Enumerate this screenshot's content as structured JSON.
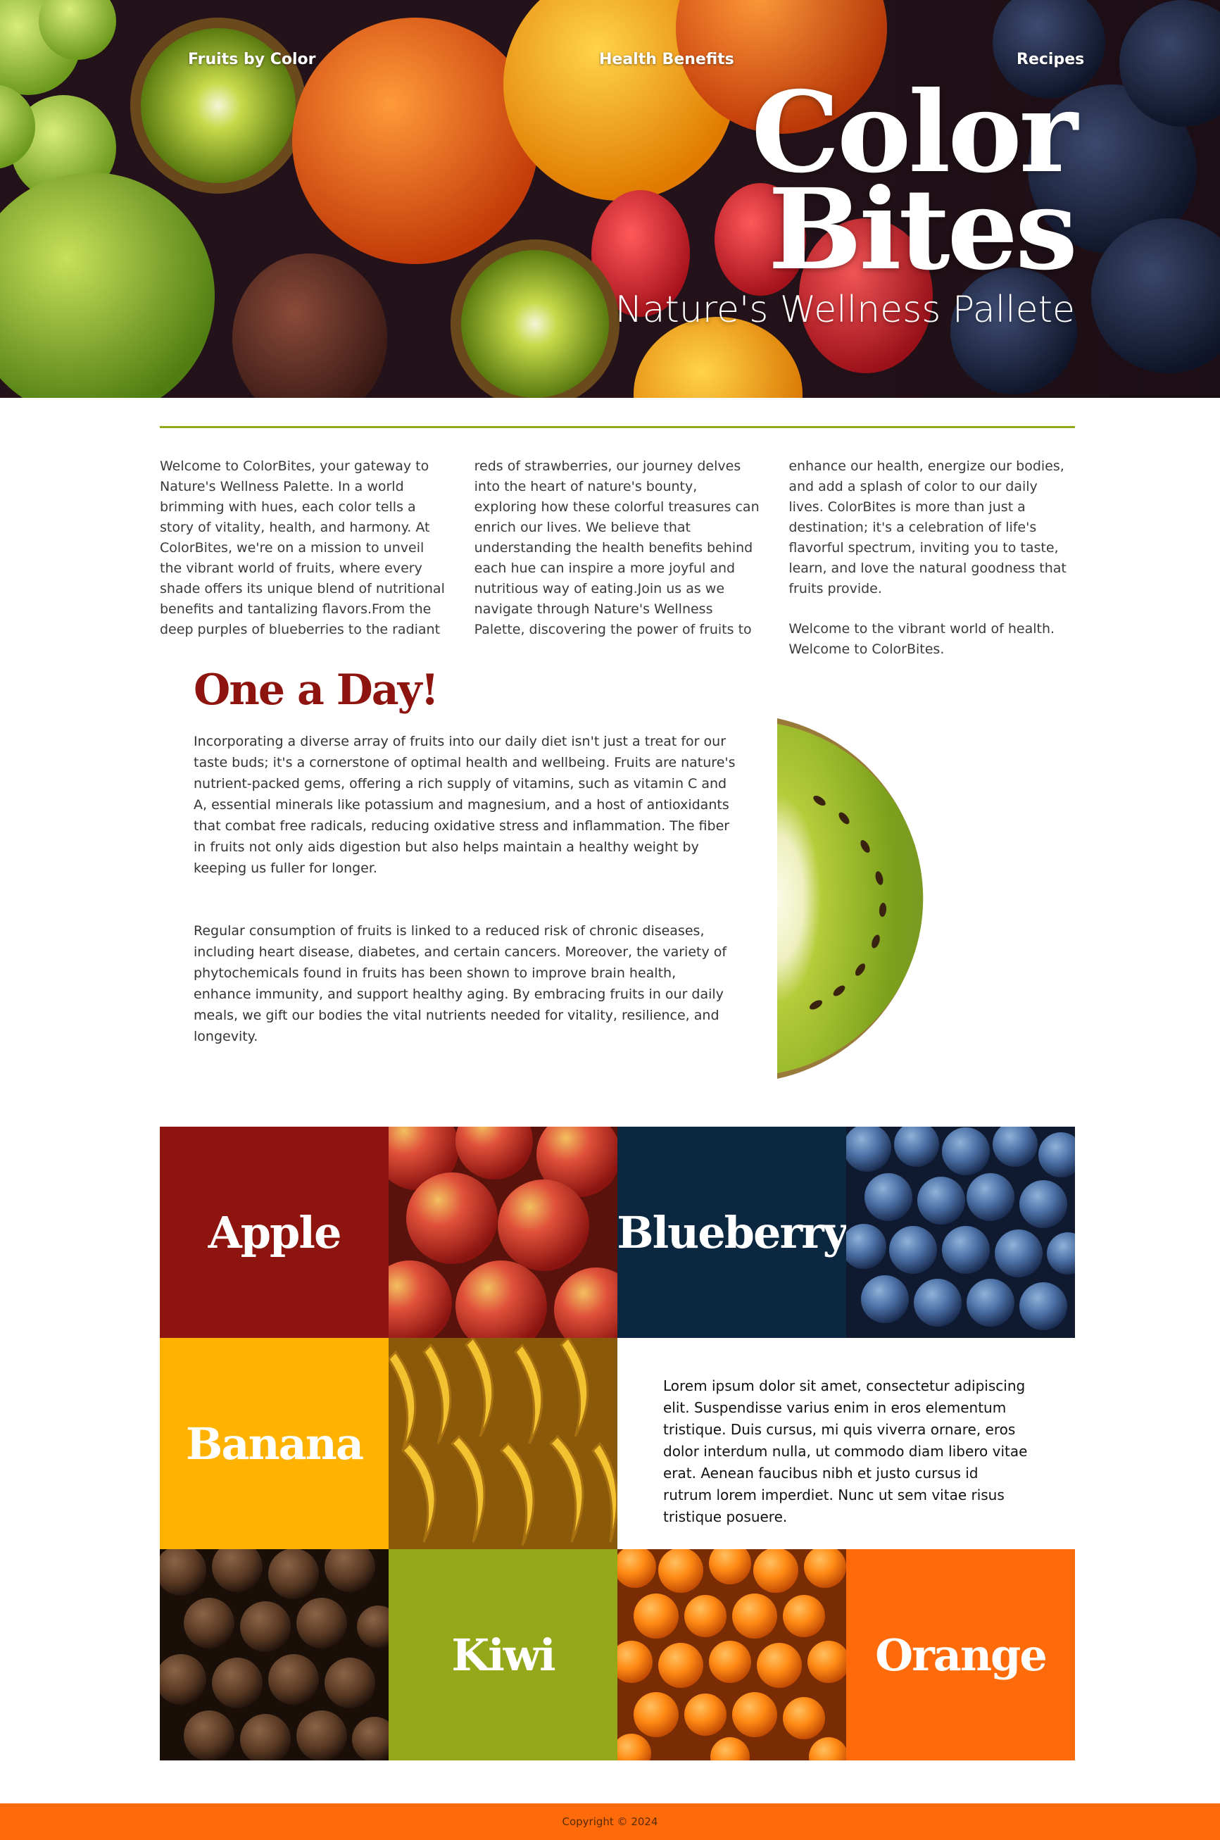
{
  "nav": {
    "fruits_by_color": "Fruits by Color",
    "health_benefits": "Health Benefits",
    "recipes": "Recipes"
  },
  "hero": {
    "title_line1": "Color",
    "title_line2": "Bites",
    "subtitle": "Nature's Wellness Pallete"
  },
  "intro": {
    "paragraph1": "Welcome to ColorBites, your gateway to Nature's Wellness Palette. In a world brimming with hues, each color tells a story of vitality, health, and harmony. At ColorBites, we're on a mission to unveil the vibrant world of fruits, where every shade offers its unique blend of nutritional benefits and tantalizing flavors.From the deep purples of blueberries to the radiant reds of strawberries, our journey delves into the heart of nature's bounty, exploring how these colorful treasures can enrich our lives. We believe that understanding the health benefits behind each hue can inspire a more joyful and nutritious way of eating.Join us as we navigate through Nature's Wellness Palette, discovering the power of fruits to enhance our health, energize our bodies, and add a splash of color to our daily lives. ColorBites is more than just a destination; it's a celebration of life's flavorful spectrum, inviting you to taste, learn, and love the natural goodness that fruits provide.",
    "paragraph2": "Welcome to the vibrant world of health. Welcome to ColorBites."
  },
  "one_a_day": {
    "heading": "One a Day!",
    "paragraph1": "Incorporating a diverse array of fruits into our daily diet isn't just a treat for our taste buds; it's a cornerstone of optimal health and wellbeing. Fruits are nature's nutrient-packed gems, offering a rich supply of vitamins, such as vitamin C and A, essential minerals like potassium and magnesium, and a host of antioxidants that combat free radicals, reducing oxidative stress and inflammation. The fiber in fruits not only aids digestion but also helps maintain a healthy weight by keeping us fuller for longer.",
    "paragraph2": "Regular consumption of fruits is linked to a reduced risk of chronic diseases, including heart disease, diabetes, and certain cancers. Moreover, the variety of phytochemicals found in fruits has been shown to improve brain health, enhance immunity, and support healthy aging. By embracing fruits in our daily meals, we gift our bodies the vital nutrients needed for vitality, resilience, and longevity."
  },
  "grid": {
    "apple": "Apple",
    "blueberry": "Blueberry",
    "banana": "Banana",
    "kiwi": "Kiwi",
    "orange": "Orange",
    "lorem": "Lorem ipsum dolor sit amet, consectetur adipiscing elit. Suspendisse varius enim in eros elementum tristique. Duis cursus, mi quis viverra ornare, eros dolor interdum nulla, ut commodo diam libero vitae erat. Aenean faucibus nibh et justo cursus id rutrum lorem imperdiet. Nunc ut sem vitae risus tristique posuere."
  },
  "colors": {
    "apple": "#8e150f",
    "blueberry": "#0b2840",
    "banana": "#ffb300",
    "kiwi": "#94a81a",
    "orange": "#ff6b0a",
    "divider": "#94a81a"
  },
  "footer": {
    "copyright": "Copyright © 2024"
  }
}
